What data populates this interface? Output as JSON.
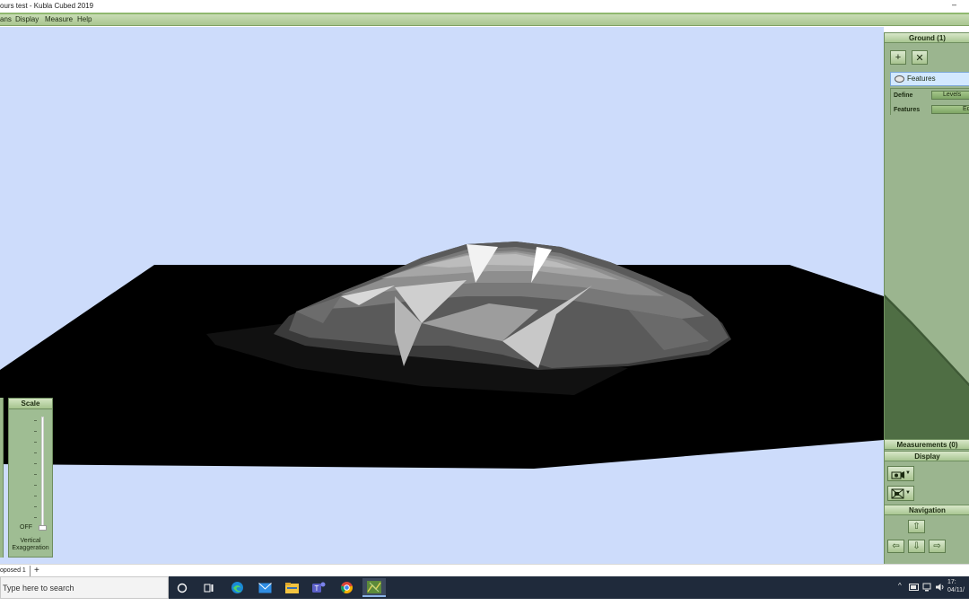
{
  "window": {
    "title": "ours test - Kubla Cubed 2019",
    "minimize_glyph": "–"
  },
  "menu": {
    "items": [
      {
        "label": "ans"
      },
      {
        "label": "Display"
      },
      {
        "label": "Measure"
      },
      {
        "label": "Help"
      }
    ]
  },
  "scale_panel": {
    "title": "Scale",
    "off_label": "OFF",
    "caption_line1": "Vertical",
    "caption_line2": "Exaggeration"
  },
  "right_panel": {
    "ground_header": "Ground (1)",
    "add_glyph": "+",
    "delete_glyph": "✕",
    "features_tab": "Features",
    "define_label": "Define",
    "define_value": "Levels",
    "features_label": "Features",
    "features_value": "Edi",
    "measurements_header": "Measurements (0)",
    "display_header": "Display",
    "navigation_header": "Navigation",
    "nav": {
      "up": "⇧",
      "left": "⇦",
      "down": "⇩",
      "right": "⇨"
    }
  },
  "bottom_tabs": {
    "tab_label": "oposed 1",
    "add_glyph": "+"
  },
  "taskbar": {
    "search_placeholder": "Type here to search",
    "tray_caret": "^",
    "clock_time": "17:",
    "clock_date": "04/11/"
  },
  "colors": {
    "viewport_bg": "#cddcfb",
    "panel_green": "#9bb58f",
    "header_green": "#a9c692",
    "taskbar": "#1f2a3b",
    "ground": "#000000"
  },
  "icons": {
    "features_tab": "terrain-layer-icon",
    "display_1": "camera-view-icon",
    "display_2": "wireframe-view-icon",
    "taskbar": [
      "cortana-circle-icon",
      "task-view-icon",
      "edge-browser-icon",
      "mail-icon",
      "file-explorer-icon",
      "teams-icon",
      "chrome-icon",
      "kubla-cubed-icon"
    ]
  }
}
